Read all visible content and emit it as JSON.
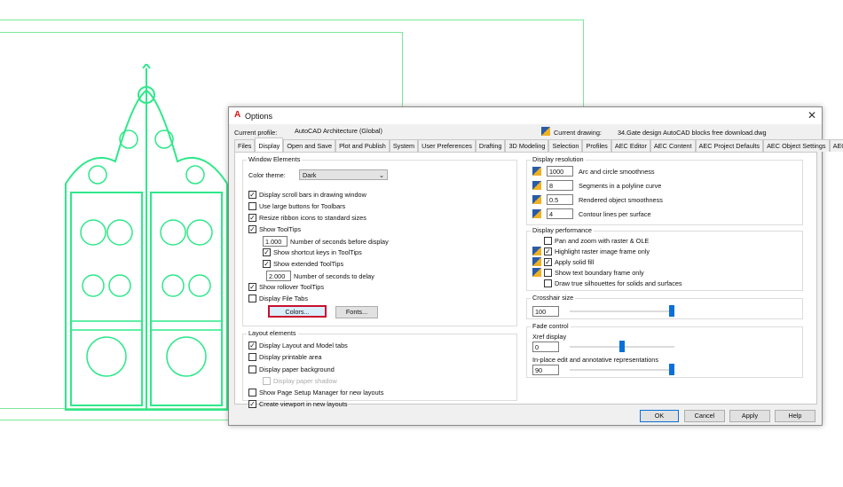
{
  "dialog": {
    "title": "Options",
    "close_icon": "close-icon",
    "profile_label": "Current profile:",
    "profile_value": "AutoCAD Architecture (Global)",
    "drawing_label": "Current drawing:",
    "drawing_value": "34.Gate design AutoCAD blocks free download.dwg"
  },
  "tabs": [
    "Files",
    "Display",
    "Open and Save",
    "Plot and Publish",
    "System",
    "User Preferences",
    "Drafting",
    "3D Modeling",
    "Selection",
    "Profiles",
    "AEC Editor",
    "AEC Content",
    "AEC Project Defaults",
    "AEC Object Settings",
    "AEC Dimension"
  ],
  "active_tab": "Display",
  "window_elements": {
    "title": "Window Elements",
    "color_theme_label": "Color theme:",
    "color_theme_value": "Dark",
    "items": [
      {
        "label": "Display scroll bars in drawing window",
        "checked": true
      },
      {
        "label": "Use large buttons for Toolbars",
        "checked": false
      },
      {
        "label": "Resize ribbon icons to standard sizes",
        "checked": true
      },
      {
        "label": "Show ToolTips",
        "checked": true
      },
      {
        "label": "Show shortcut keys in ToolTips",
        "checked": true
      },
      {
        "label": "Show extended ToolTips",
        "checked": true
      },
      {
        "label": "Show rollover ToolTips",
        "checked": true
      },
      {
        "label": "Display File Tabs",
        "checked": false
      }
    ],
    "tooltip_delay_value": "1.000",
    "tooltip_delay_label": "Number of seconds before display",
    "extended_delay_value": "2.000",
    "extended_delay_label": "Number of seconds to delay",
    "colors_button": "Colors...",
    "fonts_button": "Fonts..."
  },
  "layout_elements": {
    "title": "Layout elements",
    "items": [
      {
        "label": "Display Layout and Model tabs",
        "checked": true
      },
      {
        "label": "Display printable area",
        "checked": false
      },
      {
        "label": "Display paper background",
        "checked": false
      },
      {
        "label": "Display paper shadow",
        "checked": false,
        "disabled": true
      },
      {
        "label": "Show Page Setup Manager for new layouts",
        "checked": false
      },
      {
        "label": "Create viewport in new layouts",
        "checked": true
      }
    ]
  },
  "display_resolution": {
    "title": "Display resolution",
    "items": [
      {
        "value": "1000",
        "label": "Arc and circle smoothness"
      },
      {
        "value": "8",
        "label": "Segments in a polyline curve"
      },
      {
        "value": "0.5",
        "label": "Rendered object smoothness"
      },
      {
        "value": "4",
        "label": "Contour lines per surface"
      }
    ]
  },
  "display_performance": {
    "title": "Display performance",
    "items": [
      {
        "label": "Pan and zoom with raster & OLE",
        "checked": false,
        "icon": false
      },
      {
        "label": "Highlight raster image frame only",
        "checked": true,
        "icon": true
      },
      {
        "label": "Apply solid fill",
        "checked": true,
        "icon": true
      },
      {
        "label": "Show text boundary frame only",
        "checked": false,
        "icon": true
      },
      {
        "label": "Draw true silhouettes for solids and surfaces",
        "checked": false,
        "icon": false
      }
    ]
  },
  "crosshair": {
    "title": "Crosshair size",
    "value": "100",
    "slider_level": 1.0
  },
  "fade": {
    "title": "Fade control",
    "xref_label": "Xref display",
    "xref_value": "0",
    "xref_slider_level": 0.5,
    "inplace_label": "In-place edit and annotative representations",
    "inplace_value": "90",
    "inplace_slider_level": 1.0
  },
  "buttons": {
    "ok": "OK",
    "cancel": "Cancel",
    "apply": "Apply",
    "help": "Help"
  },
  "colors": {
    "drawing_lines": "#7be89a",
    "gate": "#2ee88a",
    "slider": "#0a6fd8",
    "highlight": "#c8102e"
  }
}
